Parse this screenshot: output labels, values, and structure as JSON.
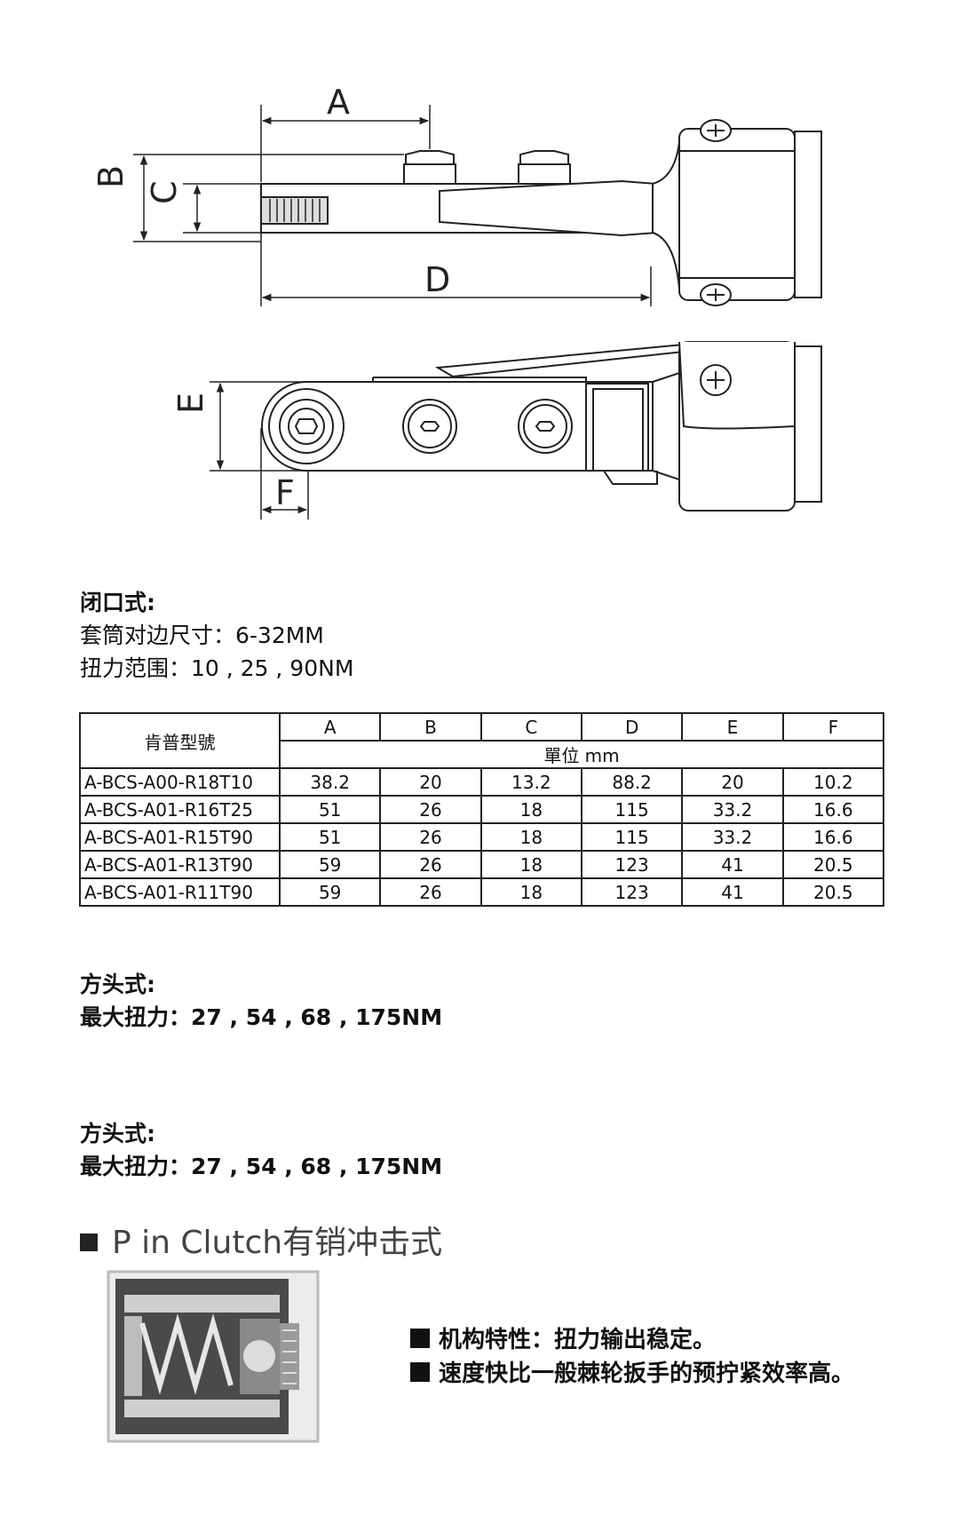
{
  "drawing": {
    "dim_labels": {
      "a": "A",
      "b": "B",
      "c": "C",
      "d": "D",
      "e": "E",
      "f": "F"
    }
  },
  "spec_closed": {
    "heading": "闭口式:",
    "line1": "套筒对边尺寸：6-32MM",
    "line2": "扭力范围：10 , 25 , 90NM"
  },
  "table": {
    "model_header": "肯普型號",
    "columns": [
      "A",
      "B",
      "C",
      "D",
      "E",
      "F"
    ],
    "unit": "單位 mm",
    "rows": [
      {
        "model": "A-BCS-A00-R18T10",
        "values": [
          "38.2",
          "20",
          "13.2",
          "88.2",
          "20",
          "10.2"
        ]
      },
      {
        "model": "A-BCS-A01-R16T25",
        "values": [
          "51",
          "26",
          "18",
          "115",
          "33.2",
          "16.6"
        ]
      },
      {
        "model": "A-BCS-A01-R15T90",
        "values": [
          "51",
          "26",
          "18",
          "115",
          "33.2",
          "16.6"
        ]
      },
      {
        "model": "A-BCS-A01-R13T90",
        "values": [
          "59",
          "26",
          "18",
          "123",
          "41",
          "20.5"
        ]
      },
      {
        "model": "A-BCS-A01-R11T90",
        "values": [
          "59",
          "26",
          "18",
          "123",
          "41",
          "20.5"
        ]
      }
    ]
  },
  "spec_square_1": {
    "heading": "方头式:",
    "line1": "最大扭力：27 , 54 , 68 , 175NM"
  },
  "spec_square_2": {
    "heading": "方头式:",
    "line1": "最大扭力：27 , 54 , 68 , 175NM"
  },
  "pin_clutch": {
    "title": "P in Clutch有销冲击式",
    "features": [
      "机构特性：扭力输出稳定。",
      "速度快比一般棘轮扳手的预拧紧效率高。"
    ]
  }
}
